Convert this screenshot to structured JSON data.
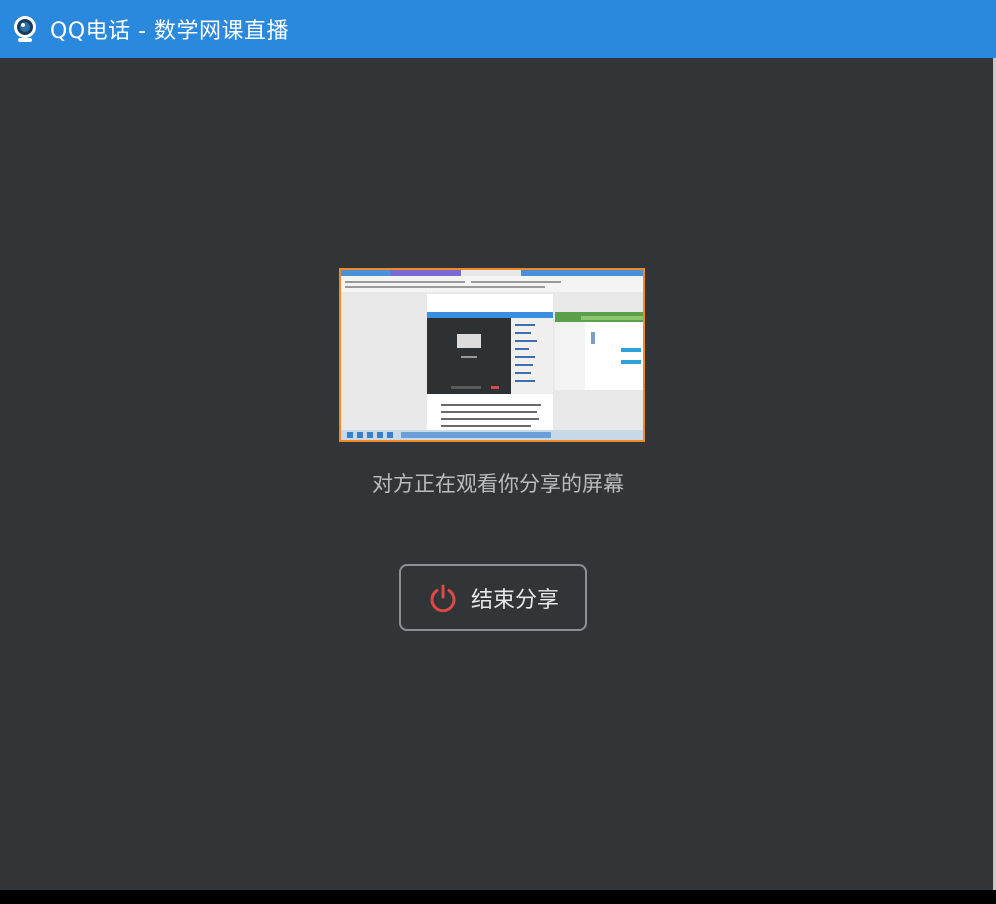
{
  "window": {
    "title": "QQ电话 - 数学网课直播",
    "icon": "qq-call-camera-icon",
    "titlebar_color": "#2a88dd",
    "background_color": "#323538"
  },
  "share": {
    "preview_image": "shared-screen-thumbnail",
    "status_text": "对方正在观看你分享的屏幕",
    "end_button": {
      "label": "结束分享",
      "icon": "power-icon",
      "icon_color": "#e04848"
    }
  }
}
